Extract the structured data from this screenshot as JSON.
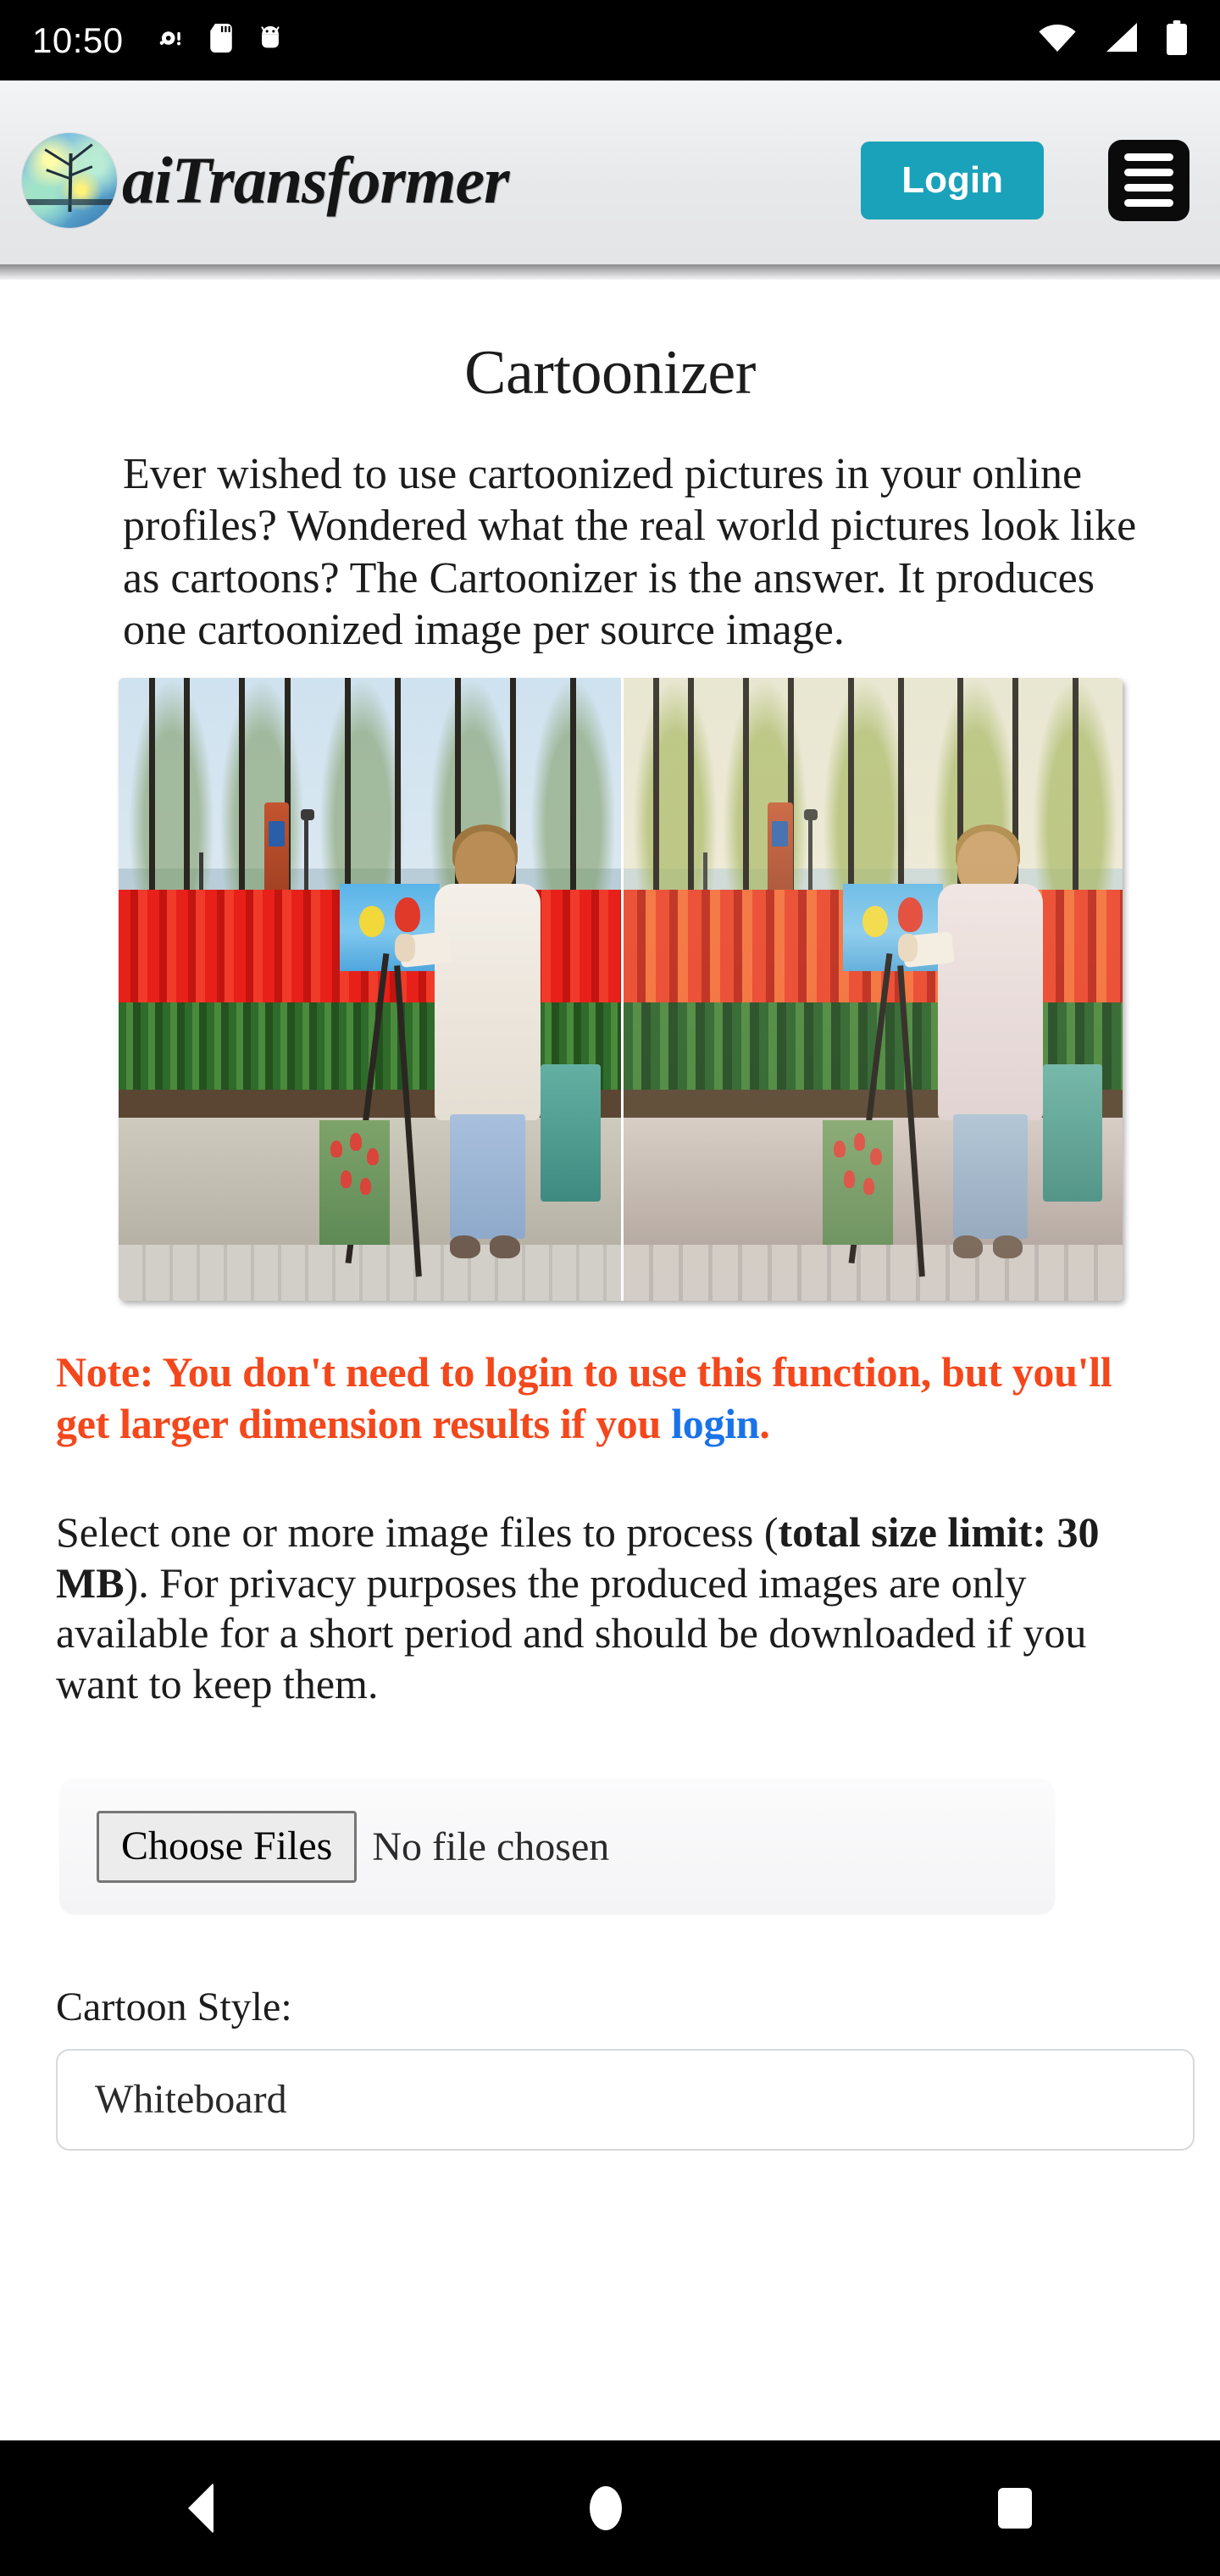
{
  "statusbar": {
    "time": "10:50",
    "left_icons": [
      "record-icon",
      "sd-card-icon",
      "android-icon"
    ],
    "right_icons": [
      "wifi-icon",
      "cell-signal-icon",
      "battery-icon"
    ]
  },
  "header": {
    "brand_name": "aiTransformer",
    "logo_icon": "tree-logo-icon",
    "login_label": "Login",
    "menu_icon": "hamburger-menu-icon"
  },
  "main": {
    "title": "Cartoonizer",
    "intro": "Ever wished to use cartoonized pictures in your online profiles? Wondered what the real world pictures look like as cartoons? The Cartoonizer is the answer. It produces one cartoonized image per source image.",
    "example_image_alt": "Side-by-side before and after example: woman painting tulips in a park, original photo left and cartoonized version right",
    "note_before_link": "Note: You don't need to login to use this function, but you'll get larger dimension results if you ",
    "note_link": "login",
    "note_after_link": ".",
    "select_para_1": "Select one or more image files to process (",
    "select_para_bold": "total size limit: 30 MB",
    "select_para_2": "). For privacy purposes the produced images are only available for a short period and should be downloaded if you want to keep them.",
    "choose_files_label": "Choose Files",
    "no_file_chosen": "No file chosen",
    "cartoon_style_label": "Cartoon Style:",
    "cartoon_style_value": "Whiteboard"
  },
  "navbar": {
    "back_icon": "back-triangle-icon",
    "home_icon": "home-circle-icon",
    "recents_icon": "recents-square-icon"
  },
  "colors": {
    "accent_teal": "#1aa2bb",
    "note_red": "#f4471c",
    "link_blue": "#1a73e8",
    "header_bg": "#e7e8ea"
  }
}
